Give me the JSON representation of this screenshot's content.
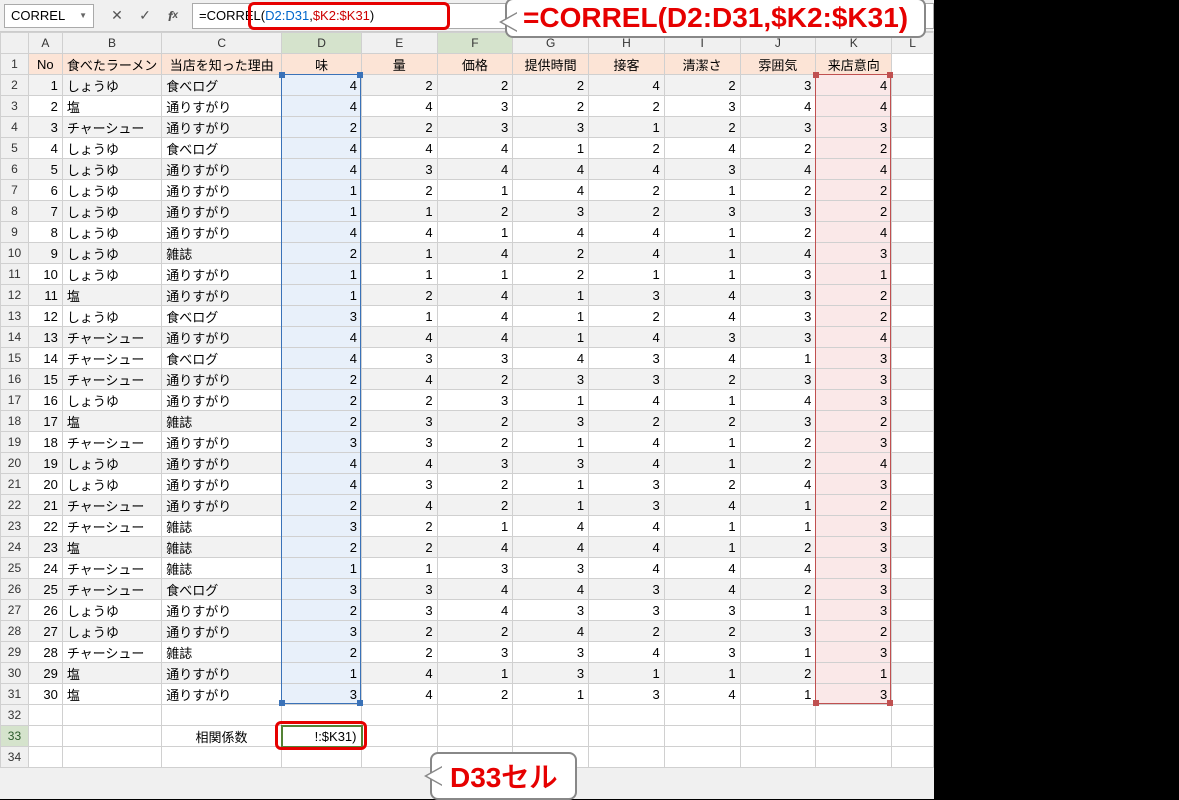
{
  "nameBox": "CORREL",
  "formula": {
    "prefix": "=CORREL(",
    "r1": "D2:D31",
    "sep": ",",
    "r2": "$K2:$K31",
    "suffix": ")"
  },
  "callout1": "=CORREL(D2:D31,$K2:$K31)",
  "callout2": "D33セル",
  "columns": [
    "A",
    "B",
    "C",
    "D",
    "E",
    "F",
    "G",
    "H",
    "I",
    "J",
    "K",
    "L"
  ],
  "headers": [
    "No",
    "食べたラーメン",
    "当店を知った理由",
    "味",
    "量",
    "価格",
    "提供時間",
    "接客",
    "清潔さ",
    "雰囲気",
    "来店意向"
  ],
  "corrLabel": "相関係数",
  "d33display": "!:$K31)",
  "rows": [
    {
      "no": 1,
      "ramen": "しょうゆ",
      "reason": "食べログ",
      "vals": [
        4,
        2,
        2,
        2,
        4,
        2,
        3,
        4
      ]
    },
    {
      "no": 2,
      "ramen": "塩",
      "reason": "通りすがり",
      "vals": [
        4,
        4,
        3,
        2,
        2,
        3,
        4,
        4
      ]
    },
    {
      "no": 3,
      "ramen": "チャーシュー",
      "reason": "通りすがり",
      "vals": [
        2,
        2,
        3,
        3,
        1,
        2,
        3,
        3
      ]
    },
    {
      "no": 4,
      "ramen": "しょうゆ",
      "reason": "食べログ",
      "vals": [
        4,
        4,
        4,
        1,
        2,
        4,
        2,
        2
      ]
    },
    {
      "no": 5,
      "ramen": "しょうゆ",
      "reason": "通りすがり",
      "vals": [
        4,
        3,
        4,
        4,
        4,
        3,
        4,
        4
      ]
    },
    {
      "no": 6,
      "ramen": "しょうゆ",
      "reason": "通りすがり",
      "vals": [
        1,
        2,
        1,
        4,
        2,
        1,
        2,
        2
      ]
    },
    {
      "no": 7,
      "ramen": "しょうゆ",
      "reason": "通りすがり",
      "vals": [
        1,
        1,
        2,
        3,
        2,
        3,
        3,
        2
      ]
    },
    {
      "no": 8,
      "ramen": "しょうゆ",
      "reason": "通りすがり",
      "vals": [
        4,
        4,
        1,
        4,
        4,
        1,
        2,
        4
      ]
    },
    {
      "no": 9,
      "ramen": "しょうゆ",
      "reason": "雑誌",
      "vals": [
        2,
        1,
        4,
        2,
        4,
        1,
        4,
        3
      ]
    },
    {
      "no": 10,
      "ramen": "しょうゆ",
      "reason": "通りすがり",
      "vals": [
        1,
        1,
        1,
        2,
        1,
        1,
        3,
        1
      ]
    },
    {
      "no": 11,
      "ramen": "塩",
      "reason": "通りすがり",
      "vals": [
        1,
        2,
        4,
        1,
        3,
        4,
        3,
        2
      ]
    },
    {
      "no": 12,
      "ramen": "しょうゆ",
      "reason": "食べログ",
      "vals": [
        3,
        1,
        4,
        1,
        2,
        4,
        3,
        2
      ]
    },
    {
      "no": 13,
      "ramen": "チャーシュー",
      "reason": "通りすがり",
      "vals": [
        4,
        4,
        4,
        1,
        4,
        3,
        3,
        4
      ]
    },
    {
      "no": 14,
      "ramen": "チャーシュー",
      "reason": "食べログ",
      "vals": [
        4,
        3,
        3,
        4,
        3,
        4,
        1,
        3
      ]
    },
    {
      "no": 15,
      "ramen": "チャーシュー",
      "reason": "通りすがり",
      "vals": [
        2,
        4,
        2,
        3,
        3,
        2,
        3,
        3
      ]
    },
    {
      "no": 16,
      "ramen": "しょうゆ",
      "reason": "通りすがり",
      "vals": [
        2,
        2,
        3,
        1,
        4,
        1,
        4,
        3
      ]
    },
    {
      "no": 17,
      "ramen": "塩",
      "reason": "雑誌",
      "vals": [
        2,
        3,
        2,
        3,
        2,
        2,
        3,
        2
      ]
    },
    {
      "no": 18,
      "ramen": "チャーシュー",
      "reason": "通りすがり",
      "vals": [
        3,
        3,
        2,
        1,
        4,
        1,
        2,
        3
      ]
    },
    {
      "no": 19,
      "ramen": "しょうゆ",
      "reason": "通りすがり",
      "vals": [
        4,
        4,
        3,
        3,
        4,
        1,
        2,
        4
      ]
    },
    {
      "no": 20,
      "ramen": "しょうゆ",
      "reason": "通りすがり",
      "vals": [
        4,
        3,
        2,
        1,
        3,
        2,
        4,
        3
      ]
    },
    {
      "no": 21,
      "ramen": "チャーシュー",
      "reason": "通りすがり",
      "vals": [
        2,
        4,
        2,
        1,
        3,
        4,
        1,
        2
      ]
    },
    {
      "no": 22,
      "ramen": "チャーシュー",
      "reason": "雑誌",
      "vals": [
        3,
        2,
        1,
        4,
        4,
        1,
        1,
        3
      ]
    },
    {
      "no": 23,
      "ramen": "塩",
      "reason": "雑誌",
      "vals": [
        2,
        2,
        4,
        4,
        4,
        1,
        2,
        3
      ]
    },
    {
      "no": 24,
      "ramen": "チャーシュー",
      "reason": "雑誌",
      "vals": [
        1,
        1,
        3,
        3,
        4,
        4,
        4,
        3
      ]
    },
    {
      "no": 25,
      "ramen": "チャーシュー",
      "reason": "食べログ",
      "vals": [
        3,
        3,
        4,
        4,
        3,
        4,
        2,
        3
      ]
    },
    {
      "no": 26,
      "ramen": "しょうゆ",
      "reason": "通りすがり",
      "vals": [
        2,
        3,
        4,
        3,
        3,
        3,
        1,
        3
      ]
    },
    {
      "no": 27,
      "ramen": "しょうゆ",
      "reason": "通りすがり",
      "vals": [
        3,
        2,
        2,
        4,
        2,
        2,
        3,
        2
      ]
    },
    {
      "no": 28,
      "ramen": "チャーシュー",
      "reason": "雑誌",
      "vals": [
        2,
        2,
        3,
        3,
        4,
        3,
        1,
        3
      ]
    },
    {
      "no": 29,
      "ramen": "塩",
      "reason": "通りすがり",
      "vals": [
        1,
        4,
        1,
        3,
        1,
        1,
        2,
        1
      ]
    },
    {
      "no": 30,
      "ramen": "塩",
      "reason": "通りすがり",
      "vals": [
        3,
        4,
        2,
        1,
        3,
        4,
        1,
        3
      ]
    }
  ]
}
